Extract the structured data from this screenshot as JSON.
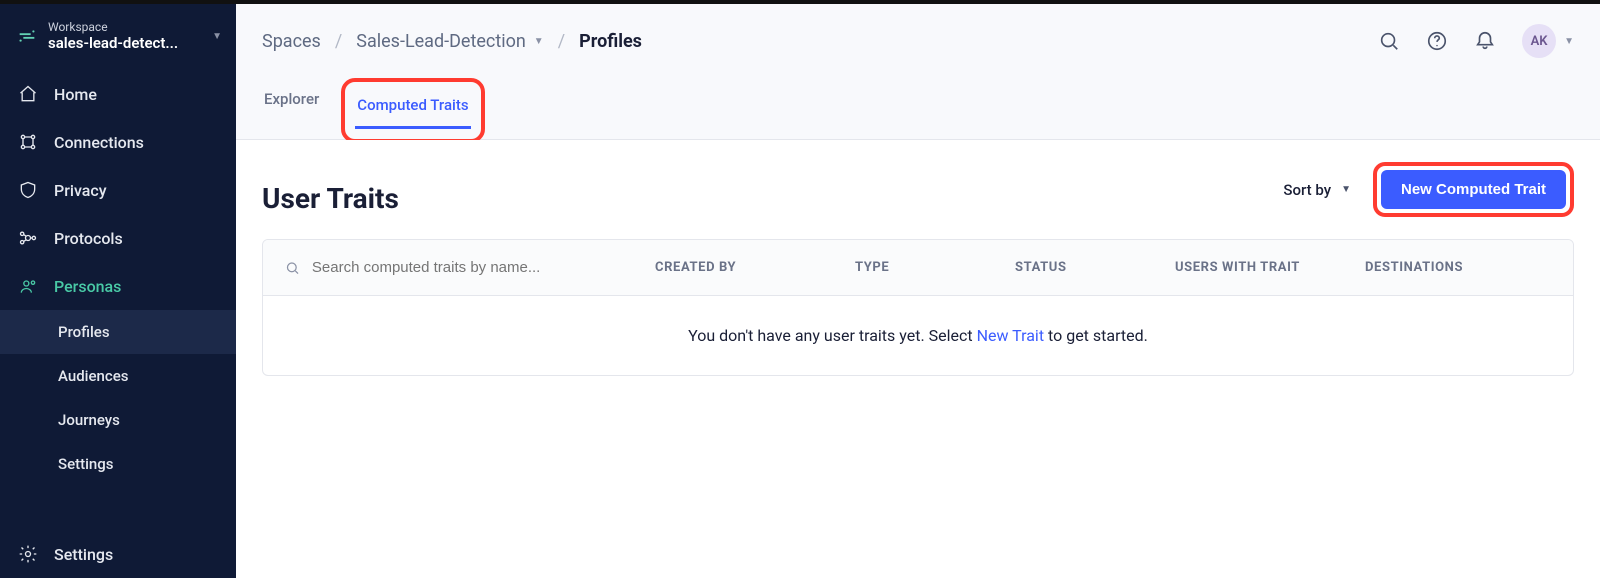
{
  "workspace": {
    "label": "Workspace",
    "name": "sales-lead-detect..."
  },
  "sidebar": {
    "items": [
      {
        "label": "Home"
      },
      {
        "label": "Connections"
      },
      {
        "label": "Privacy"
      },
      {
        "label": "Protocols"
      },
      {
        "label": "Personas"
      }
    ],
    "personas_sub": [
      {
        "label": "Profiles"
      },
      {
        "label": "Audiences"
      },
      {
        "label": "Journeys"
      },
      {
        "label": "Settings"
      }
    ],
    "settings": "Settings"
  },
  "breadcrumbs": {
    "root": "Spaces",
    "space": "Sales-Lead-Detection",
    "page": "Profiles"
  },
  "user": {
    "initials": "AK"
  },
  "tabs": [
    {
      "label": "Explorer"
    },
    {
      "label": "Computed Traits"
    }
  ],
  "page": {
    "title": "User Traits",
    "sort_label": "Sort by",
    "new_trait_button": "New Computed Trait",
    "search_placeholder": "Search computed traits by name...",
    "columns": {
      "created_by": "CREATED BY",
      "type": "TYPE",
      "status": "STATUS",
      "users_with_trait": "USERS WITH TRAIT",
      "destinations": "DESTINATIONS"
    },
    "empty": {
      "prefix": "You don't have any user traits yet. Select ",
      "link": "New Trait",
      "suffix": " to get started."
    }
  }
}
